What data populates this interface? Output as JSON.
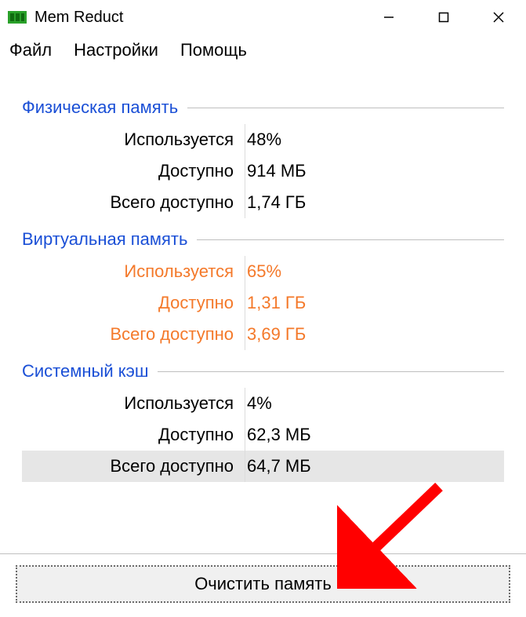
{
  "window": {
    "title": "Mem Reduct"
  },
  "menu": {
    "file": "Файл",
    "settings": "Настройки",
    "help": "Помощь"
  },
  "sections": {
    "phys": {
      "title": "Физическая память",
      "used_label": "Используется",
      "used_value": "48%",
      "avail_label": "Доступно",
      "avail_value": "914 МБ",
      "total_label": "Всего доступно",
      "total_value": "1,74 ГБ"
    },
    "virt": {
      "title": "Виртуальная память",
      "used_label": "Используется",
      "used_value": "65%",
      "avail_label": "Доступно",
      "avail_value": "1,31 ГБ",
      "total_label": "Всего доступно",
      "total_value": "3,69 ГБ"
    },
    "cache": {
      "title": "Системный кэш",
      "used_label": "Используется",
      "used_value": "4%",
      "avail_label": "Доступно",
      "avail_value": "62,3 МБ",
      "total_label": "Всего доступно",
      "total_value": "64,7 МБ"
    }
  },
  "footer": {
    "clear_button": "Очистить память"
  },
  "colors": {
    "section_header": "#1a4fd6",
    "warning": "#f4792a",
    "arrow": "#ff0000"
  }
}
